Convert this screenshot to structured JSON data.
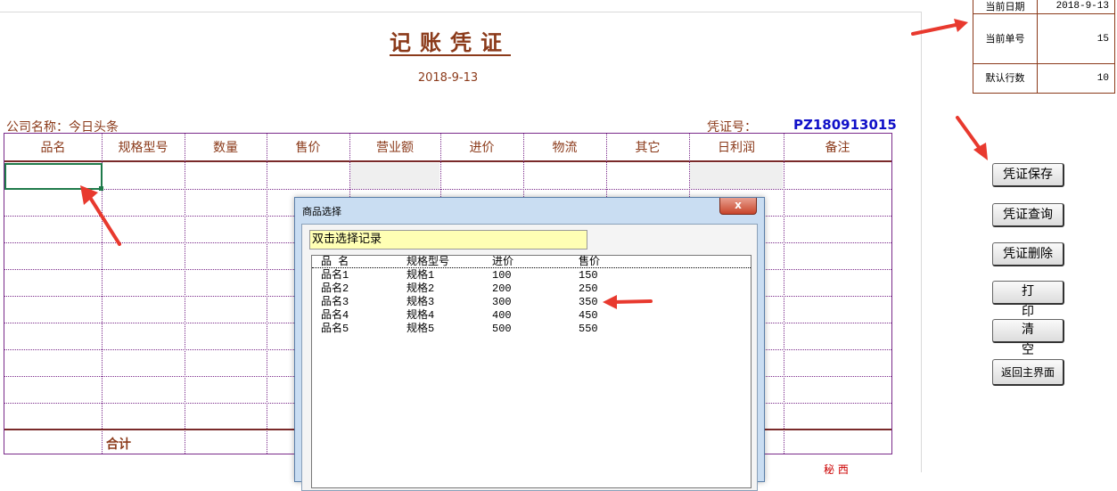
{
  "voucher": {
    "title": "记账凭证",
    "date": "2018-9-13",
    "company": "公司名称：今日头条",
    "voucher_label": "凭证号：",
    "voucher_no": "PZ180913015",
    "total_label": "合计"
  },
  "table": {
    "columns": [
      "品名",
      "规格型号",
      "数量",
      "售价",
      "营业额",
      "进价",
      "物流",
      "其它",
      "日利润",
      "备注"
    ]
  },
  "info_panel": {
    "rows": [
      {
        "label": "当前日期",
        "value": "2018-9-13"
      },
      {
        "label": "当前单号",
        "value": "15"
      },
      {
        "label": "默认行数",
        "value": "10"
      }
    ]
  },
  "buttons": {
    "save": "凭证保存",
    "query": "凭证查询",
    "delete": "凭证删除",
    "print": "打印",
    "clear": "清空",
    "back": "返回主界面"
  },
  "dialog": {
    "title": "商品选择",
    "close_label": "x",
    "hint": "双击选择记录",
    "headers": [
      "品 名",
      "规格型号",
      "进价",
      "售价"
    ],
    "rows": [
      [
        "品名1",
        "规格1",
        "100",
        "150"
      ],
      [
        "品名2",
        "规格2",
        "200",
        "250"
      ],
      [
        "品名3",
        "规格3",
        "300",
        "350"
      ],
      [
        "品名4",
        "规格4",
        "400",
        "450"
      ],
      [
        "品名5",
        "规格5",
        "500",
        "550"
      ]
    ]
  },
  "footer": {
    "partial_text": "秘 西"
  },
  "colors": {
    "accent_brown": "#8b3a1a",
    "voucher_blue": "#1010c8",
    "grid_purple": "#7a2a8a",
    "hint_yellow": "#ffffb4",
    "arrow_red": "#e8392e"
  }
}
